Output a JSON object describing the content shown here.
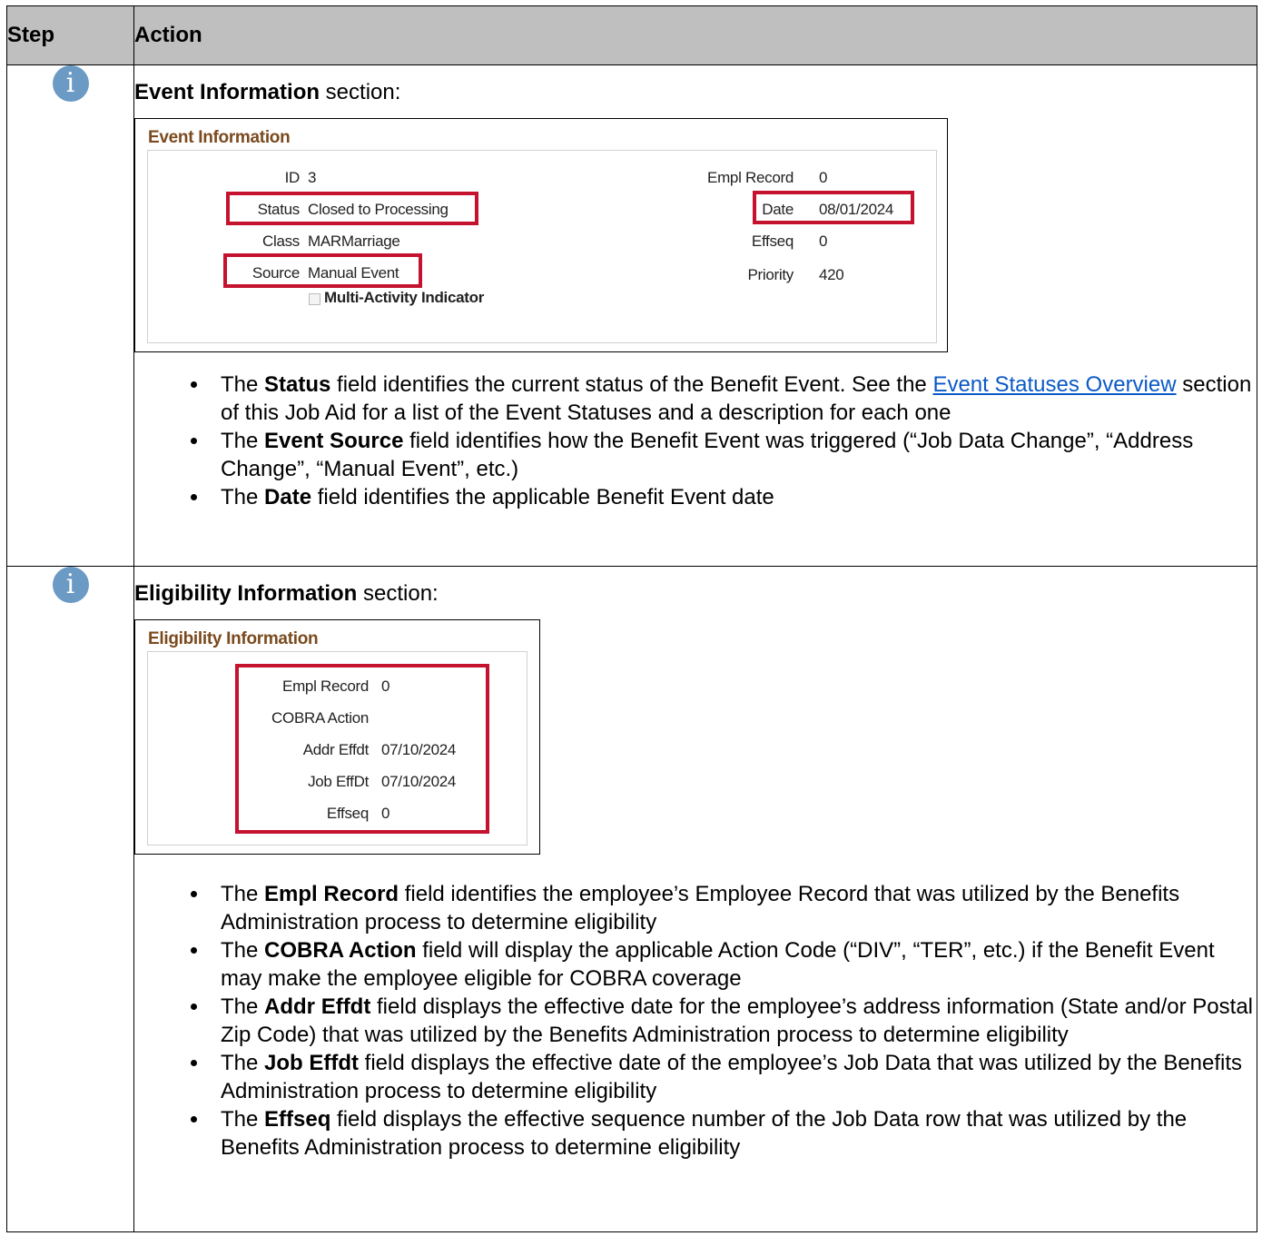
{
  "table": {
    "header": {
      "step": "Step",
      "action": "Action"
    }
  },
  "row1": {
    "icon": "info-icon",
    "heading": {
      "bold": "Event Information",
      "rest": " section:"
    },
    "panel": {
      "title": "Event Information",
      "id_label": "ID",
      "id_value": "3",
      "status_label": "Status",
      "status_value": "Closed to Processing",
      "class_label": "Class",
      "class_value": "MARMarriage",
      "source_label": "Source",
      "source_value": "Manual Event",
      "multi_activity_label": "Multi-Activity Indicator",
      "multi_activity_checked": false,
      "empl_record_label": "Empl Record",
      "empl_record_value": "0",
      "date_label": "Date",
      "date_value": "08/01/2024",
      "effseq_label": "Effseq",
      "effseq_value": "0",
      "priority_label": "Priority",
      "priority_value": "420"
    },
    "bullets": {
      "b1_pre": "The ",
      "b1_bold": "Status",
      "b1_mid": " field identifies the current status of the Benefit Event.  See the ",
      "b1_link": "Event Statuses Overview",
      "b1_post": " section of this Job Aid for a list of the Event Statuses and a description for each one",
      "b2_pre": "The ",
      "b2_bold": "Event Source",
      "b2_post": " field identifies how the Benefit Event was triggered (“Job Data Change”, “Address Change”, “Manual Event”, etc.)",
      "b3_pre": "The ",
      "b3_bold": "Date",
      "b3_post": " field identifies the applicable Benefit Event date"
    }
  },
  "row2": {
    "icon": "info-icon",
    "heading": {
      "bold": "Eligibility Information",
      "rest": " section:"
    },
    "panel": {
      "title": "Eligibility Information",
      "empl_record_label": "Empl Record",
      "empl_record_value": "0",
      "cobra_label": "COBRA Action",
      "cobra_value": "",
      "addr_effdt_label": "Addr Effdt",
      "addr_effdt_value": "07/10/2024",
      "job_effdt_label": "Job EffDt",
      "job_effdt_value": "07/10/2024",
      "effseq_label": "Effseq",
      "effseq_value": "0"
    },
    "bullets": {
      "b1_pre": "The ",
      "b1_bold": "Empl Record",
      "b1_post": " field identifies the employee’s Employee Record that was utilized by the Benefits Administration process to determine eligibility",
      "b2_pre": "The ",
      "b2_bold": "COBRA Action",
      "b2_post": " field will display the applicable Action Code (“DIV”, “TER”, etc.) if the Benefit Event may make the employee eligible for COBRA coverage",
      "b3_pre": "The ",
      "b3_bold": "Addr Effdt",
      "b3_post": " field displays the effective date for the employee’s address information (State and/or Postal Zip Code) that was utilized by the Benefits Administration process to determine eligibility",
      "b4_pre": "The ",
      "b4_bold": "Job Effdt",
      "b4_post": " field displays the effective date of the employee’s Job Data that was utilized by the Benefits Administration process to determine eligibility",
      "b5_pre": "The ",
      "b5_bold": "Effseq",
      "b5_post": " field displays the effective sequence number of the Job Data row that was utilized by the Benefits Administration process to determine eligibility"
    }
  },
  "colors": {
    "header_bg": "#bfbfbf",
    "highlight": "#c4122f",
    "panel_title": "#7a4a1e",
    "link": "#0b59c6",
    "icon": "#6b9ac4"
  }
}
